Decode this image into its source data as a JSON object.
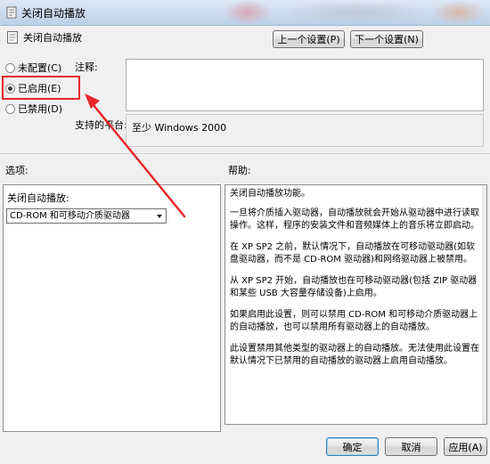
{
  "window": {
    "title": "关闭自动播放"
  },
  "header": {
    "policy_name": "关闭自动播放"
  },
  "nav": {
    "prev_label": "上一个设置(P)",
    "next_label": "下一个设置(N)"
  },
  "options": {
    "not_configured": "未配置(C)",
    "enabled": "已启用(E)",
    "disabled": "已禁用(D)",
    "selected": "enabled"
  },
  "comment": {
    "label": "注释:",
    "value": ""
  },
  "platform": {
    "label": "支持的平台:",
    "value": "至少 Windows 2000"
  },
  "sections": {
    "options_label": "选项:",
    "help_label": "帮助:"
  },
  "left_panel": {
    "setting_label": "关闭自动播放:",
    "drive_select": {
      "value": "CD-ROM 和可移动介质驱动器"
    }
  },
  "help": {
    "paragraphs": [
      "关闭自动播放功能。",
      "一旦将介质插入驱动器，自动播放就会开始从驱动器中进行读取操作。这样，程序的安装文件和音频媒体上的音乐将立即启动。",
      "在 XP SP2 之前，默认情况下，自动播放在可移动驱动器(如软盘驱动器，而不是 CD-ROM 驱动器)和网络驱动器上被禁用。",
      "从 XP SP2 开始，自动播放也在可移动驱动器(包括 ZIP 驱动器和某些 USB 大容量存储设备)上启用。",
      "如果启用此设置，则可以禁用 CD-ROM 和可移动介质驱动器上的自动播放，也可以禁用所有驱动器上的自动播放。",
      "此设置禁用其他类型的驱动器上的自动播放。无法使用此设置在默认情况下已禁用的自动播放的驱动器上启用自动播放。"
    ]
  },
  "footer": {
    "ok_label": "确定",
    "cancel_label": "取消",
    "apply_label": "应用(A)"
  },
  "colors": {
    "highlight_box": "#e8262b",
    "annotation_arrow": "#e8262b"
  }
}
